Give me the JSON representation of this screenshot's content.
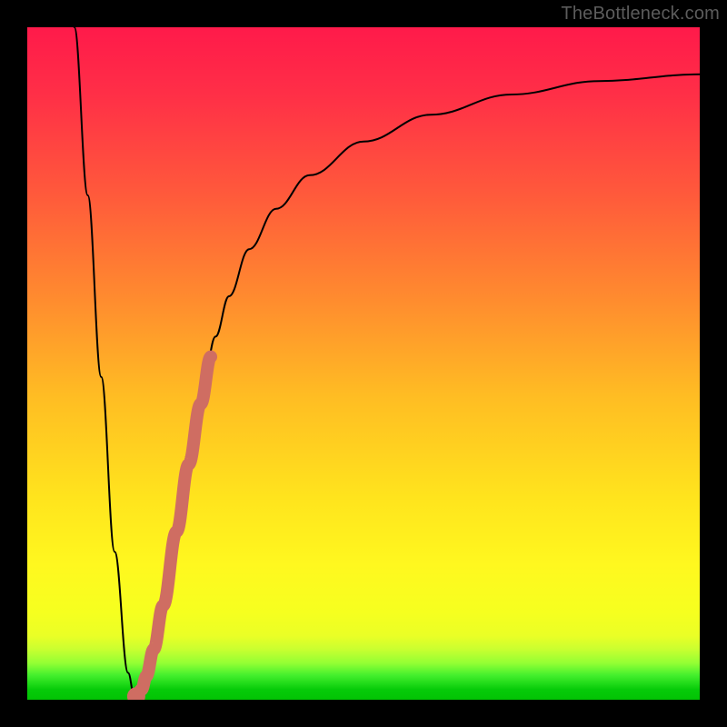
{
  "watermark": "TheBottleneck.com",
  "colors": {
    "frame": "#000000",
    "curve": "#000000",
    "highlight": "#cf6d62",
    "green_band_top": "#a8ef55",
    "green_band_bottom": "#05c805",
    "gradient_stops": [
      {
        "offset": 0.0,
        "color": "#ff1a4a"
      },
      {
        "offset": 0.1,
        "color": "#ff2f47"
      },
      {
        "offset": 0.25,
        "color": "#ff5a3b"
      },
      {
        "offset": 0.4,
        "color": "#ff8a2f"
      },
      {
        "offset": 0.55,
        "color": "#ffbd23"
      },
      {
        "offset": 0.7,
        "color": "#ffe41d"
      },
      {
        "offset": 0.8,
        "color": "#fff81f"
      },
      {
        "offset": 0.87,
        "color": "#f6ff1f"
      },
      {
        "offset": 0.905,
        "color": "#eaff26"
      },
      {
        "offset": 0.925,
        "color": "#c9ff30"
      },
      {
        "offset": 0.946,
        "color": "#92ff34"
      },
      {
        "offset": 0.963,
        "color": "#46f02e"
      },
      {
        "offset": 0.985,
        "color": "#06cb09"
      },
      {
        "offset": 1.0,
        "color": "#02c304"
      }
    ]
  },
  "chart_data": {
    "type": "line",
    "title": "",
    "xlabel": "",
    "ylabel": "",
    "xlim": [
      0,
      100
    ],
    "ylim": [
      0,
      100
    ],
    "series": [
      {
        "name": "bottleneck-curve",
        "x": [
          7,
          9,
          11,
          13,
          15,
          16,
          17,
          18,
          20,
          22,
          24,
          26,
          28,
          30,
          33,
          37,
          42,
          50,
          60,
          72,
          85,
          100
        ],
        "y": [
          100,
          75,
          48,
          22,
          4,
          0,
          1,
          4,
          14,
          26,
          37,
          46,
          54,
          60,
          67,
          73,
          78,
          83,
          87,
          90,
          92,
          93
        ]
      },
      {
        "name": "highlight-segment",
        "x": [
          16.2,
          17.0,
          17.7,
          18.8,
          20.2,
          22.2,
          24.0,
          25.8,
          27.3
        ],
        "y": [
          0.5,
          1.5,
          3.5,
          7.5,
          14.0,
          25.0,
          35.0,
          44.0,
          51.0
        ]
      }
    ],
    "annotations": []
  }
}
